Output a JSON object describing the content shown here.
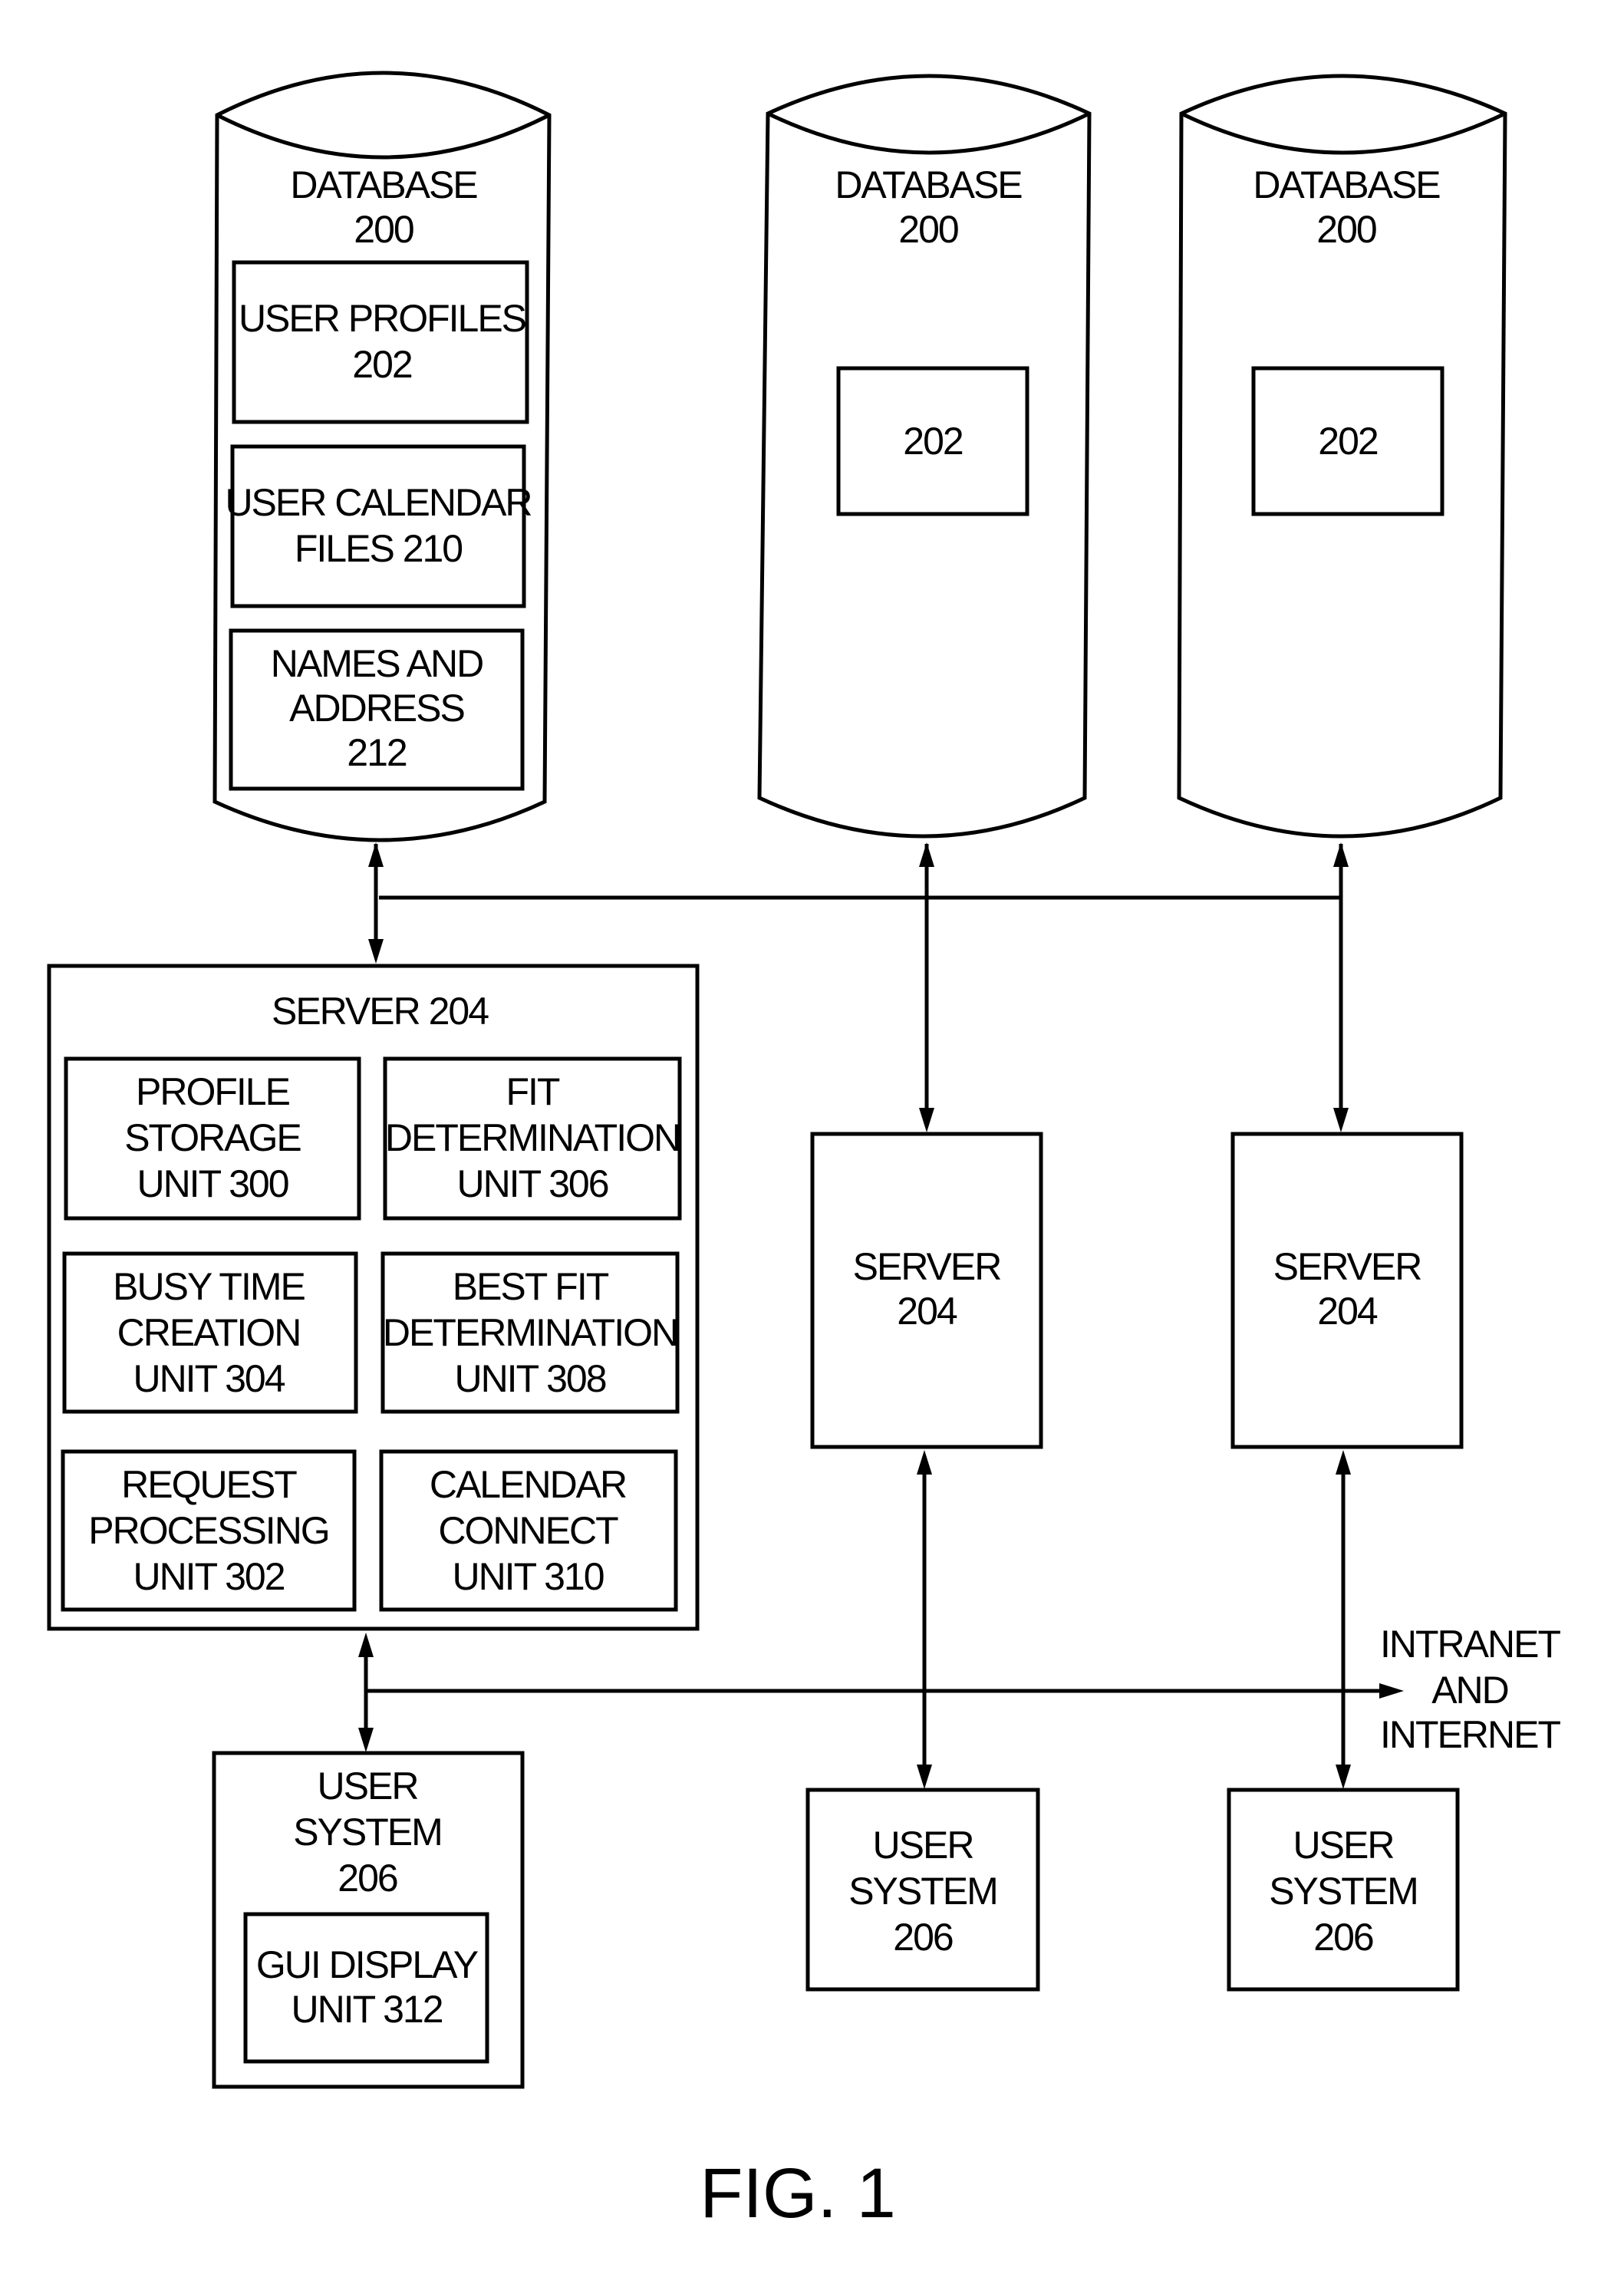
{
  "figure_label": "FIG. 1",
  "databases": [
    {
      "lines": [
        "DATABASE",
        "200"
      ],
      "items": [
        {
          "lines": [
            "USER PROFILES",
            "202"
          ]
        },
        {
          "lines": [
            "USER CALENDAR",
            "FILES 210"
          ]
        },
        {
          "lines": [
            "NAMES AND",
            "ADDRESS",
            "212"
          ]
        }
      ]
    },
    {
      "lines": [
        "DATABASE",
        "200"
      ],
      "items": [
        {
          "lines": [
            "202"
          ]
        }
      ]
    },
    {
      "lines": [
        "DATABASE",
        "200"
      ],
      "items": [
        {
          "lines": [
            "202"
          ]
        }
      ]
    }
  ],
  "main_server": {
    "title": "SERVER 204",
    "units": [
      {
        "lines": [
          "PROFILE",
          "STORAGE",
          "UNIT  300"
        ]
      },
      {
        "lines": [
          "FIT",
          "DETERMINATION",
          "UNIT 306"
        ]
      },
      {
        "lines": [
          "BUSY TIME",
          "CREATION",
          "UNIT 304"
        ]
      },
      {
        "lines": [
          "BEST FIT",
          "DETERMINATION",
          "UNIT 308"
        ]
      },
      {
        "lines": [
          "REQUEST",
          "PROCESSING",
          "UNIT 302"
        ]
      },
      {
        "lines": [
          "CALENDAR",
          "CONNECT",
          "UNIT  310"
        ]
      }
    ]
  },
  "servers": [
    {
      "lines": [
        "SERVER",
        "204"
      ]
    },
    {
      "lines": [
        "SERVER",
        "204"
      ]
    }
  ],
  "user_systems": [
    {
      "lines": [
        "USER",
        "SYSTEM",
        "206"
      ],
      "inner": {
        "lines": [
          "GUI DISPLAY",
          "UNIT 312"
        ]
      }
    },
    {
      "lines": [
        "USER",
        "SYSTEM",
        "206"
      ]
    },
    {
      "lines": [
        "USER",
        "SYSTEM",
        "206"
      ]
    }
  ],
  "network_label": {
    "lines": [
      "INTRANET",
      "AND",
      "INTERNET"
    ]
  }
}
